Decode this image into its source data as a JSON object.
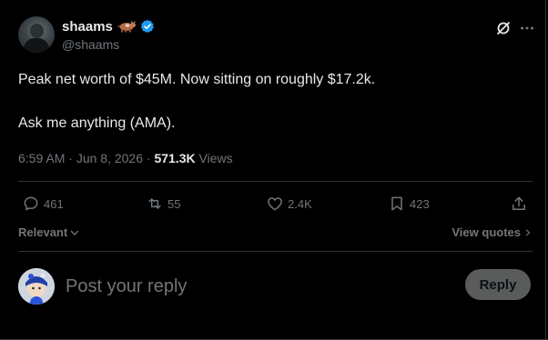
{
  "colors": {
    "background": "#000000",
    "text_primary": "#e7e9ea",
    "text_secondary": "#71767b",
    "verified_blue": "#1d9bf0",
    "reply_button_bg": "#787a7a"
  },
  "author": {
    "display_name": "shaams",
    "name_emoji": "cow-icon",
    "verified": true,
    "handle": "@shaams"
  },
  "tweet": {
    "lines": [
      "Peak net worth of $45M. Now sitting on roughly $17.2k.",
      "Ask me anything (AMA)."
    ]
  },
  "meta": {
    "time": "6:59 AM",
    "separator": "·",
    "date": "Jun 8, 2026",
    "views_count": "571.3K",
    "views_label": "Views"
  },
  "actions": {
    "replies": "461",
    "reposts": "55",
    "likes": "2.4K",
    "bookmarks": "423"
  },
  "sort": {
    "label": "Relevant"
  },
  "quotes": {
    "label": "View quotes"
  },
  "reply": {
    "placeholder": "Post your reply",
    "button_label": "Reply"
  }
}
